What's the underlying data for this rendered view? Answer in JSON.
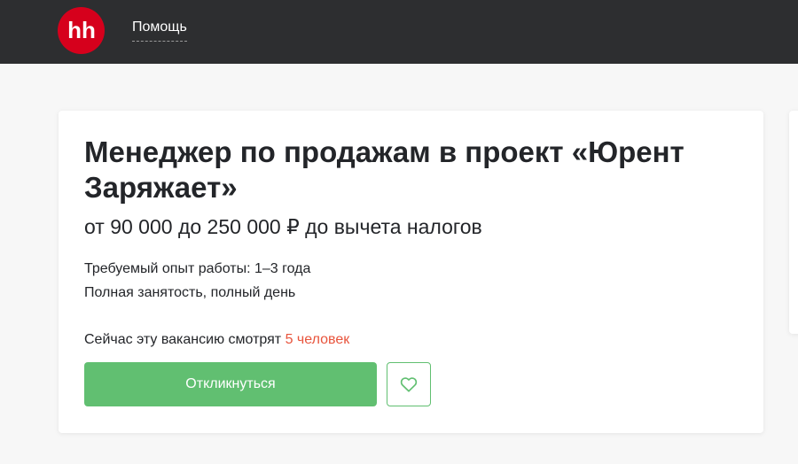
{
  "header": {
    "logo_text": "hh",
    "help_link": "Помощь"
  },
  "vacancy": {
    "title": "Менеджер по продажам в проект «Юрент Заряжает»",
    "salary": "от 90 000 до 250 000 ₽ до вычета налогов",
    "experience": "Требуемый опыт работы: 1–3 года",
    "employment": "Полная занятость, полный день",
    "viewers_prefix": "Сейчас эту вакансию смотрят ",
    "viewers_count": "5 человек",
    "respond_label": "Откликнуться"
  },
  "icons": {
    "logo": "hh-logo-icon",
    "favorite": "heart-icon"
  },
  "colors": {
    "header_bg": "#2d2e30",
    "logo_red": "#d6001c",
    "accent_green": "#61bf71",
    "viewers_count": "#e8543c"
  }
}
